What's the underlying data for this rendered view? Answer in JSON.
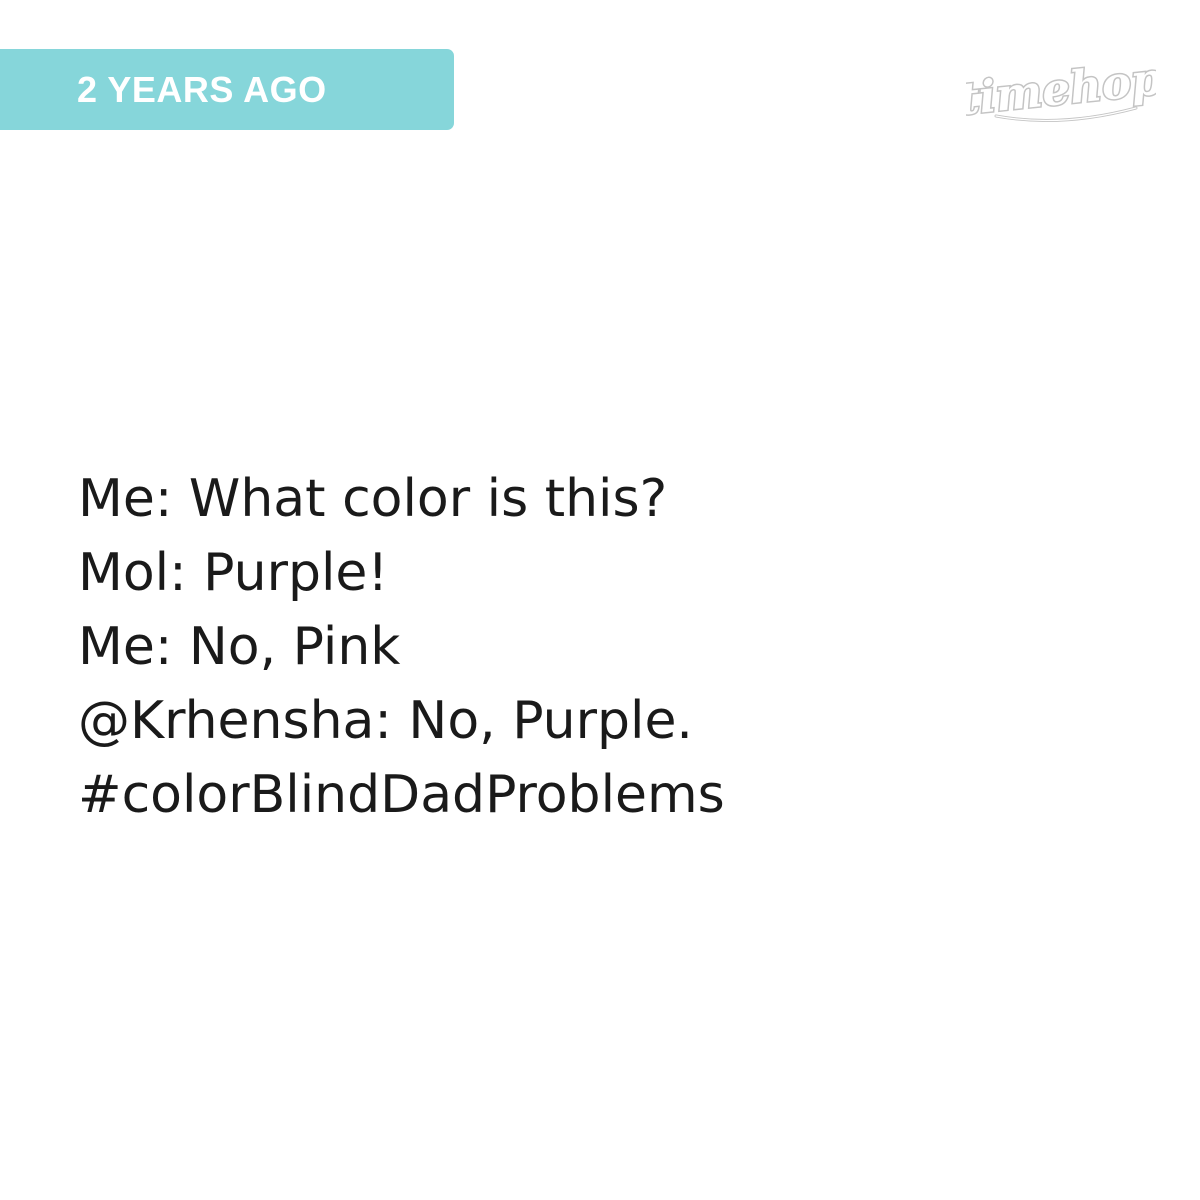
{
  "header": {
    "badge_label": "2 YEARS AGO",
    "badge_color": "#86d6da",
    "logo_text": "timehop",
    "logo_icon": "timehop-logo-icon"
  },
  "post": {
    "lines": [
      "Me: What color is this?",
      "Mol: Purple!",
      "Me: No, Pink",
      "@Krhensha: No, Purple.",
      "#colorBlindDadProblems"
    ],
    "text_color": "#1a1a1a"
  }
}
